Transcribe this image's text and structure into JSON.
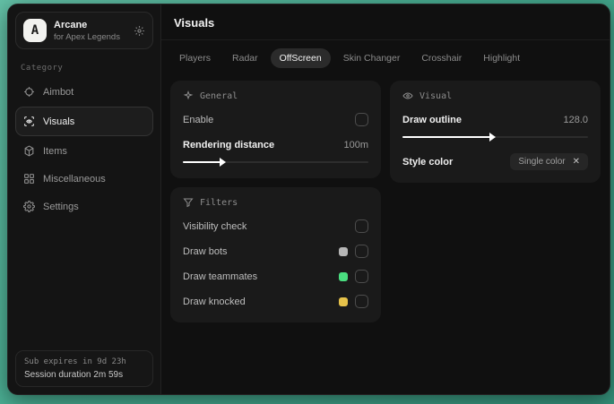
{
  "app": {
    "name": "Arcane",
    "subtitle": "for Apex Legends",
    "logo_letter": "A"
  },
  "sidebar": {
    "category_label": "Category",
    "items": [
      {
        "label": "Aimbot",
        "icon": "crosshair-icon",
        "active": false
      },
      {
        "label": "Visuals",
        "icon": "eye-scan-icon",
        "active": true
      },
      {
        "label": "Items",
        "icon": "package-icon",
        "active": false
      },
      {
        "label": "Miscellaneous",
        "icon": "grid-icon",
        "active": false
      },
      {
        "label": "Settings",
        "icon": "gear-icon",
        "active": false
      }
    ],
    "footer": {
      "sub_expires": "Sub expires in 9d 23h",
      "session_duration": "Session duration 2m 59s"
    }
  },
  "header": {
    "title": "Visuals"
  },
  "tabs": [
    {
      "label": "Players",
      "active": false
    },
    {
      "label": "Radar",
      "active": false
    },
    {
      "label": "OffScreen",
      "active": true
    },
    {
      "label": "Skin Changer",
      "active": false
    },
    {
      "label": "Crosshair",
      "active": false
    },
    {
      "label": "Highlight",
      "active": false
    }
  ],
  "panels": {
    "general": {
      "title": "General",
      "enable_label": "Enable",
      "enable_checked": false,
      "slider_label": "Rendering distance",
      "slider_value": "100m",
      "slider_percent": 21
    },
    "visual": {
      "title": "Visual",
      "outline_label": "Draw outline",
      "outline_value": "128.0",
      "outline_percent": 48,
      "style_label": "Style color",
      "style_value": "Single color",
      "style_remove": "✕"
    },
    "filters": {
      "title": "Filters",
      "rows": [
        {
          "label": "Visibility check",
          "swatch": null,
          "checked": false
        },
        {
          "label": "Draw bots",
          "swatch": "#b6b6b6",
          "checked": false
        },
        {
          "label": "Draw teammates",
          "swatch": "#4ade80",
          "checked": false
        },
        {
          "label": "Draw knocked",
          "swatch": "#e6c24a",
          "checked": false
        }
      ]
    }
  },
  "colors": {
    "backdrop_teal": "#47ab90",
    "panel_bg": "#1a1a1a",
    "active_pill": "#2b2b2b"
  }
}
